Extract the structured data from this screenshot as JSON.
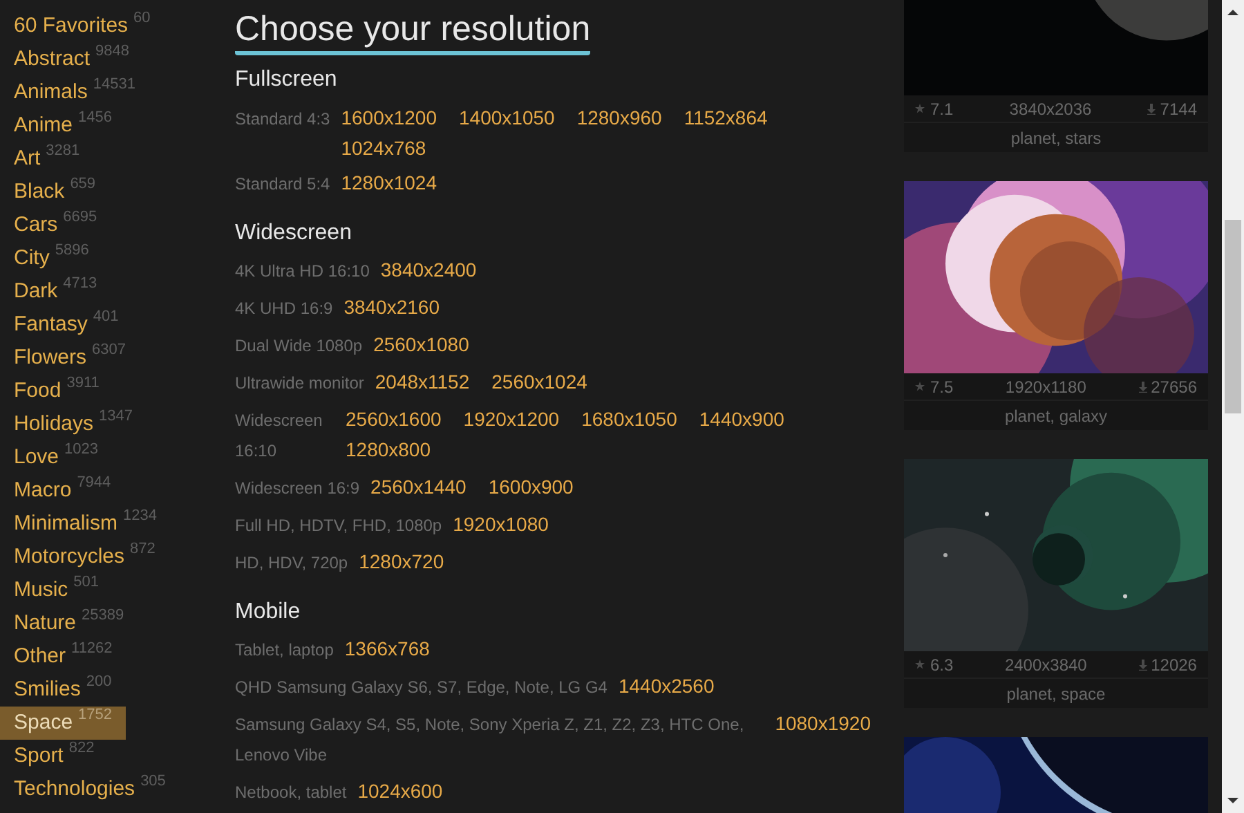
{
  "sidebar": {
    "categories": [
      {
        "name": "60 Favorites",
        "count": "60",
        "selected": false
      },
      {
        "name": "Abstract",
        "count": "9848",
        "selected": false
      },
      {
        "name": "Animals",
        "count": "14531",
        "selected": false
      },
      {
        "name": "Anime",
        "count": "1456",
        "selected": false
      },
      {
        "name": "Art",
        "count": "3281",
        "selected": false
      },
      {
        "name": "Black",
        "count": "659",
        "selected": false
      },
      {
        "name": "Cars",
        "count": "6695",
        "selected": false
      },
      {
        "name": "City",
        "count": "5896",
        "selected": false
      },
      {
        "name": "Dark",
        "count": "4713",
        "selected": false
      },
      {
        "name": "Fantasy",
        "count": "401",
        "selected": false
      },
      {
        "name": "Flowers",
        "count": "6307",
        "selected": false
      },
      {
        "name": "Food",
        "count": "3911",
        "selected": false
      },
      {
        "name": "Holidays",
        "count": "1347",
        "selected": false
      },
      {
        "name": "Love",
        "count": "1023",
        "selected": false
      },
      {
        "name": "Macro",
        "count": "7944",
        "selected": false
      },
      {
        "name": "Minimalism",
        "count": "1234",
        "selected": false
      },
      {
        "name": "Motorcycles",
        "count": "872",
        "selected": false
      },
      {
        "name": "Music",
        "count": "501",
        "selected": false
      },
      {
        "name": "Nature",
        "count": "25389",
        "selected": false
      },
      {
        "name": "Other",
        "count": "11262",
        "selected": false
      },
      {
        "name": "Smilies",
        "count": "200",
        "selected": false
      },
      {
        "name": "Space",
        "count": "1752",
        "selected": true
      },
      {
        "name": "Sport",
        "count": "822",
        "selected": false
      },
      {
        "name": "Technologies",
        "count": "305",
        "selected": false
      }
    ]
  },
  "main": {
    "title": "Choose your resolution",
    "sections": [
      {
        "title": "Fullscreen",
        "rows": [
          {
            "label": "Standard 4:3",
            "resolutions": [
              "1600x1200",
              "1400x1050",
              "1280x960",
              "1152x864",
              "1024x768"
            ]
          },
          {
            "label": "Standard 5:4",
            "resolutions": [
              "1280x1024"
            ]
          }
        ]
      },
      {
        "title": "Widescreen",
        "rows": [
          {
            "label": "4K Ultra HD 16:10",
            "resolutions": [
              "3840x2400"
            ]
          },
          {
            "label": "4K UHD 16:9",
            "resolutions": [
              "3840x2160"
            ]
          },
          {
            "label": "Dual Wide 1080p",
            "resolutions": [
              "2560x1080"
            ]
          },
          {
            "label": "Ultrawide monitor",
            "resolutions": [
              "2048x1152",
              "2560x1024"
            ]
          },
          {
            "label": "Widescreen 16:10",
            "resolutions": [
              "2560x1600",
              "1920x1200",
              "1680x1050",
              "1440x900",
              "1280x800"
            ]
          },
          {
            "label": "Widescreen 16:9",
            "resolutions": [
              "2560x1440",
              "1600x900"
            ]
          },
          {
            "label": "Full HD, HDTV, FHD, 1080p",
            "resolutions": [
              "1920x1080"
            ]
          },
          {
            "label": "HD, HDV, 720p",
            "resolutions": [
              "1280x720"
            ]
          }
        ]
      },
      {
        "title": "Mobile",
        "rows": [
          {
            "label": "Tablet, laptop",
            "resolutions": [
              "1366x768"
            ]
          },
          {
            "label": "QHD Samsung Galaxy S6, S7, Edge, Note, LG G4",
            "resolutions": [
              "1440x2560"
            ]
          },
          {
            "label": "Samsung Galaxy S4, S5, Note, Sony Xperia Z, Z1, Z2, Z3, HTC One, Lenovo Vibe",
            "resolutions": [
              "1080x1920"
            ]
          },
          {
            "label": "Netbook, tablet",
            "resolutions": [
              "1024x600"
            ]
          }
        ]
      }
    ]
  },
  "gallery": [
    {
      "kind": "card",
      "rating": "7.1",
      "resolution": "3840x2036",
      "downloads": "7144",
      "tags": "planet, stars"
    },
    {
      "kind": "card",
      "rating": "7.5",
      "resolution": "1920x1180",
      "downloads": "27656",
      "tags": "planet, galaxy"
    },
    {
      "kind": "card",
      "rating": "6.3",
      "resolution": "2400x3840",
      "downloads": "12026",
      "tags": "planet, space"
    },
    {
      "kind": "picture"
    }
  ]
}
